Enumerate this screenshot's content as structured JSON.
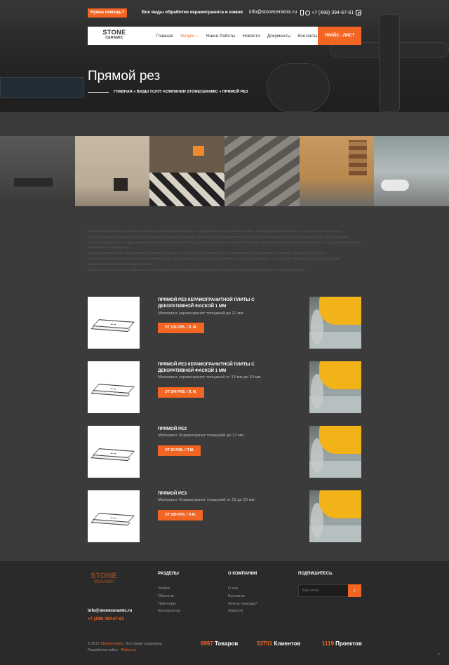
{
  "header": {
    "help_button": "Нужна помощь?",
    "tagline": "Все виды обработки керамогранита и камня",
    "email": "info@stoneceramic.ru",
    "phone": "+7 (499) 394-67-61"
  },
  "logo": {
    "word1": "STONE",
    "word2": "CERAMIC"
  },
  "nav": {
    "items": [
      "Главная",
      "Услуги ⌄",
      "Наши Работы",
      "Новости",
      "Документы",
      "Контакты"
    ],
    "active_index": 1,
    "price_button": "ПРАЙС - ЛИСТ"
  },
  "page": {
    "title": "Прямой рез",
    "breadcrumb": "ГЛАВНАЯ » ВИДЫ УСЛУГ КОМПАНИИ STONECERAMIC » ПРЯМОЙ РЕЗ"
  },
  "intro": [
    "Компания Stoneceramic предлагает прямой рез керамогранитной плиты, натурального и искусственного камня. Такой вид работ выполняется, когда в наличии нет плиты соответствующего размера, а для отделки нужна определенная форма. Прямой рез также применяется для получения бордюров, плинтусов, элементов для полуподиумных ступеней керамогранита, подрезки массивов натуральной плитки. Плиту режется насквозь на четкие по заготовке. При необходимости выполняется фаска, чтобы срез максимально соответствовал заводскому.",
    "Компания Stoneceramic обрабатывает материал толщиной до 20 мм. Работы производятся на современном оборудовании без сколов, гладкий и ровный срез.",
    "Благодаря данной технологии могут быть реализованы самые сложные архитектурные элементы. В этом же прямой рез - это простой и безопасный способ обработки.",
    "Прямой рез выполняется в каждом участке.",
    "Прямой рез выполняется в нужном месте и позволяет получить плитку и декоративные элементы необходимого формата со сложным рисунком."
  ],
  "products": [
    {
      "title": "ПРЯМОЙ РЕЗ КЕРАМОГРАНИТНОЙ ПЛИТЫ С ДЕКОРАТИВНОЙ ФАСКОЙ 1 ММ",
      "material": "Материал: керамогранит толщиной до 12 мм",
      "price": "ОТ 135 РУБ. / П. М."
    },
    {
      "title": "ПРЯМОЙ РЕЗ КЕРАМОГРАНИТНОЙ ПЛИТЫ С ДЕКОРАТИВНОЙ ФАСКОЙ 1 ММ",
      "material": "Материал: керамогранит толщиной от 13 мм до 20 мм",
      "price": "ОТ 244 РУБ. / П. М."
    },
    {
      "title": "ПРЯМОЙ РЕЗ",
      "material": "Материал: Керамогранит толщиной до 12 мм",
      "price": "ОТ 65 РУБ. / П.М."
    },
    {
      "title": "ПРЯМОЙ РЕЗ",
      "material": "Материал: Керамогранит толщиной от 13 до 20 мм",
      "price": "ОТ 180 РУБ. / П.М."
    }
  ],
  "footer": {
    "logo_word1": "STONE",
    "logo_word2": "CERAMIC",
    "email": "info@stoneceramic.ru",
    "phone": "+7 (499) 394-67-61",
    "col1_title": "РАЗДЕЛЫ",
    "col1_items": [
      "Услуги",
      "Объекты",
      "Партнеры",
      "Калькулятор"
    ],
    "col2_title": "О КОМПАНИИ",
    "col2_items": [
      "О нас",
      "Контакты",
      "Нужна помощь?",
      "Новости"
    ],
    "col3_title": "ПОДПИШИТЕСЬ",
    "subscribe_placeholder": "Ваш email",
    "subscribe_button": "›",
    "copyright_prefix": "© 2017",
    "copyright_brand": "StoneCeramic",
    "copyright_suffix": ". Все права защищены",
    "dev_prefix": "Разработка сайта -",
    "dev_name": "Webrix.ru",
    "stats": [
      {
        "num": "8997",
        "label": "Товаров"
      },
      {
        "num": "53701",
        "label": "Клиентов"
      },
      {
        "num": "1119",
        "label": "Проектов"
      }
    ]
  }
}
